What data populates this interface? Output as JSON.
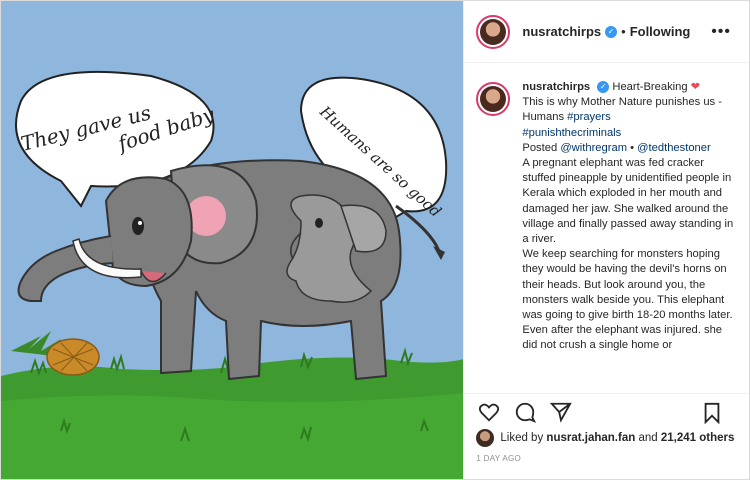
{
  "media": {
    "bubble_left_text_1": "They gave us",
    "bubble_left_text_2": "food baby",
    "bubble_right_text_1": "Humans are so good"
  },
  "header": {
    "username": "nusratchirps",
    "separator": "•",
    "follow_label": "Following",
    "more_label": "•••"
  },
  "caption": {
    "username": "nusratchirps",
    "line1": "Heart-Breaking",
    "line2": "This is why Mother Nature punishes us - Humans",
    "hashtag1": "#prayers",
    "hashtag2": "#punishthecriminals",
    "posted_label": "Posted",
    "mention1": "@withregram",
    "sep": "•",
    "mention2": "@tedthestoner",
    "body1": "A pregnant elephant was fed cracker stuffed pineapple by unidentified people in Kerala which exploded in her mouth and damaged her jaw. She walked around the village and finally passed away standing in a river.",
    "body2": "We keep searching for monsters hoping they would be having the devil's horns on their heads. But look around you, the monsters walk beside you. This elephant was going to give birth 18-20 months later.",
    "body3": "Even after the elephant was injured. she did not crush a single home or"
  },
  "likes": {
    "prefix": "Liked by",
    "user": "nusrat.jahan.fan",
    "and": "and",
    "count": "21,241 others"
  },
  "timestamp": "1 DAY AGO",
  "colors": {
    "sky": "#8fb6dd",
    "elephant": "#7d7d7d",
    "grass": "#3f9b2f",
    "heart": "#ed4956",
    "link": "#00376b",
    "verified": "#3897f0"
  }
}
